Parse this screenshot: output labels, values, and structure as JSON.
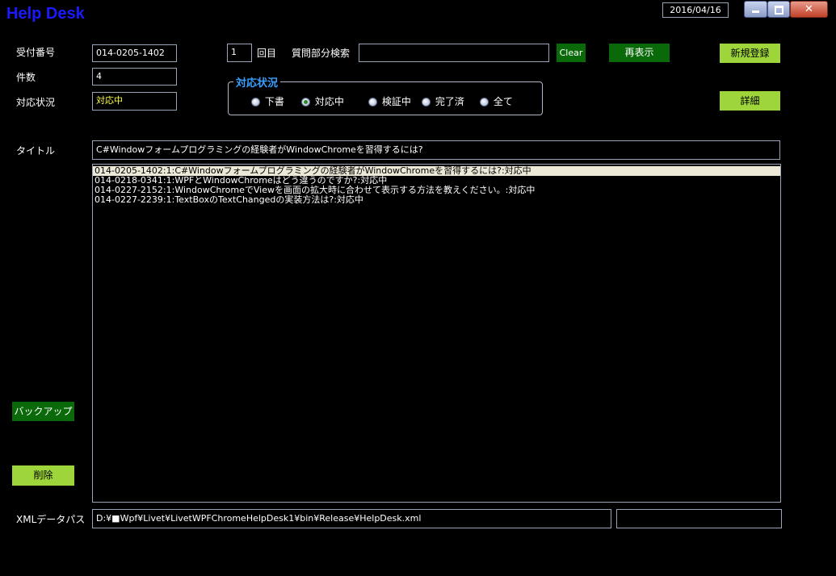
{
  "app": {
    "title": "Help Desk",
    "date": "2016/04/16"
  },
  "labels": {
    "reception_no": "受付番号",
    "count": "件数",
    "status": "対応状況",
    "times": "回目",
    "question_search": "質問部分検索",
    "title": "タイトル",
    "xml_path": "XMLデータパス"
  },
  "fields": {
    "reception_no": "014-0205-1402",
    "count": "4",
    "status": "対応中",
    "times": "1",
    "question_search": "",
    "title": "C#Windowフォームプログラミングの経験者がWindowChromeを習得するには?",
    "xml_path": "D:¥■Wpf¥Livet¥LivetWPFChromeHelpDesk1¥bin¥Release¥HelpDesk.xml",
    "extra": ""
  },
  "buttons": {
    "clear": "Clear",
    "refresh": "再表示",
    "new": "新規登録",
    "detail": "詳細",
    "backup": "バックアップ",
    "delete": "削除"
  },
  "status_group": {
    "title": "対応状況",
    "options": [
      "下書",
      "対応中",
      "検証中",
      "完了済",
      "全て"
    ],
    "selected": "対応中"
  },
  "list": [
    "014-0205-1402:1:C#Windowフォームプログラミングの経験者がWindowChromeを習得するには?:対応中",
    "014-0218-0341:1:WPFとWindowChromeはどう違うのですか?:対応中",
    "014-0227-2152:1:WindowChromeでViewを画面の拡大時に合わせて表示する方法を教えください。:対応中",
    "014-0227-2239:1:TextBoxのTextChangedの実装方法は?:対応中"
  ],
  "colors": {
    "title": "#1a1aff",
    "group_title": "#3aa0ff",
    "button_dark": "#0a6a0a",
    "button_light": "#9ed53a",
    "status_value": "#ffff40"
  }
}
